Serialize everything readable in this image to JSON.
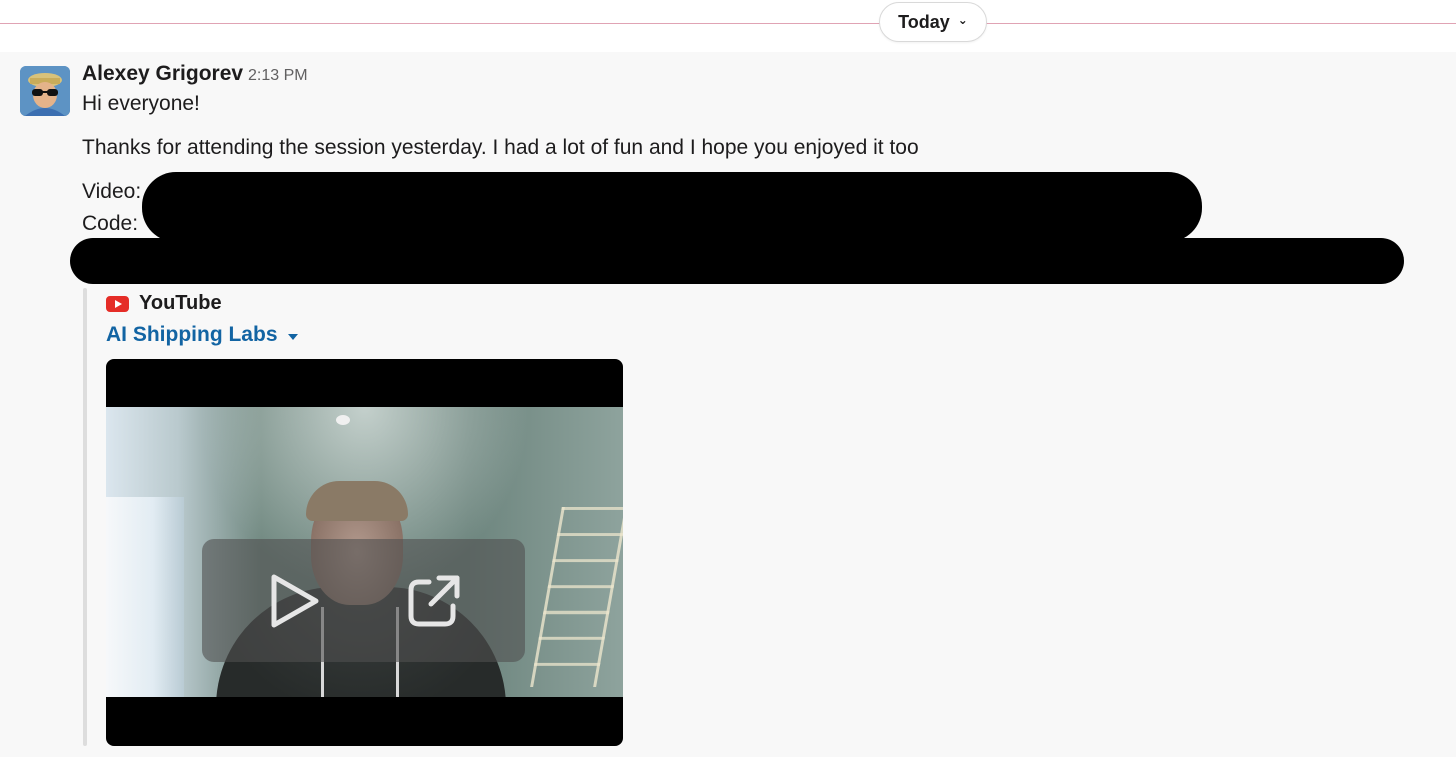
{
  "divider": {
    "label": "Today",
    "chevron": "⌄"
  },
  "message": {
    "sender": "Alexey Grigorev",
    "time": "2:13 PM",
    "line1": "Hi everyone!",
    "line2": "Thanks for attending the session yesterday. I had a lot of fun and I hope you enjoyed it too",
    "video_label": "Video:",
    "code_label": "Code:"
  },
  "attachment": {
    "source": "YouTube",
    "title": "AI Shipping Labs",
    "icons": {
      "source": "youtube-logo-icon",
      "expand": "caret-down-icon",
      "play": "play-icon",
      "open": "external-link-icon"
    }
  },
  "colors": {
    "link": "#1264a3",
    "youtube_red": "#e52d27",
    "divider_line": "#e0a3b4"
  }
}
